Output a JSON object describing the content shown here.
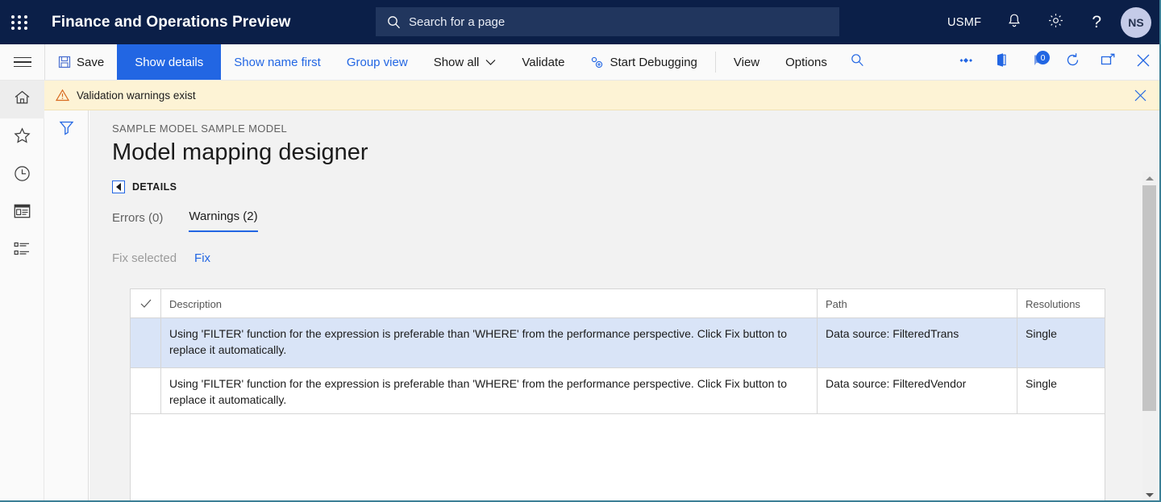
{
  "topbar": {
    "waffle_label": "App launcher",
    "app_title": "Finance and Operations Preview",
    "search_placeholder": "Search for a page",
    "company": "USMF",
    "notifications_icon": "bell-icon",
    "settings_icon": "gear-icon",
    "help_label": "?",
    "avatar_initials": "NS"
  },
  "toolbar": {
    "save_label": "Save",
    "show_details_label": "Show details",
    "show_name_first_label": "Show name first",
    "group_view_label": "Group view",
    "show_all_label": "Show all",
    "validate_label": "Validate",
    "start_debugging_label": "Start Debugging",
    "view_label": "View",
    "options_label": "Options",
    "notification_badge": "0"
  },
  "message_bar": {
    "text": "Validation warnings exist",
    "type": "warning"
  },
  "rail": {
    "items": [
      {
        "name": "home",
        "label": "Home"
      },
      {
        "name": "favorites",
        "label": "Favorites"
      },
      {
        "name": "recent",
        "label": "Recent"
      },
      {
        "name": "workspaces",
        "label": "Workspaces"
      },
      {
        "name": "modules",
        "label": "Modules"
      }
    ]
  },
  "filter_pane": {
    "filter_label": "Filter"
  },
  "page": {
    "caption": "SAMPLE MODEL SAMPLE MODEL",
    "title": "Model mapping designer",
    "details_section_label": "DETAILS"
  },
  "tabs": [
    {
      "label": "Errors (0)",
      "active": false
    },
    {
      "label": "Warnings (2)",
      "active": true
    }
  ],
  "sub_actions": {
    "fix_selected_label": "Fix selected",
    "fix_label": "Fix"
  },
  "grid": {
    "columns": [
      "",
      "Description",
      "Path",
      "Resolutions"
    ],
    "rows": [
      {
        "description": "Using 'FILTER' function for the expression is preferable than 'WHERE' from the performance perspective. Click Fix button to replace it automatically.",
        "path": "Data source: FilteredTrans",
        "resolutions": "Single",
        "selected": true
      },
      {
        "description": "Using 'FILTER' function for the expression is preferable than 'WHERE' from the performance perspective. Click Fix button to replace it automatically.",
        "path": "Data source: FilteredVendor",
        "resolutions": "Single",
        "selected": false
      }
    ]
  },
  "colors": {
    "nav_background": "#0b1f48",
    "accent": "#2266e3",
    "warning_bar": "#fdf3d5",
    "row_selected": "#d9e4f7"
  }
}
